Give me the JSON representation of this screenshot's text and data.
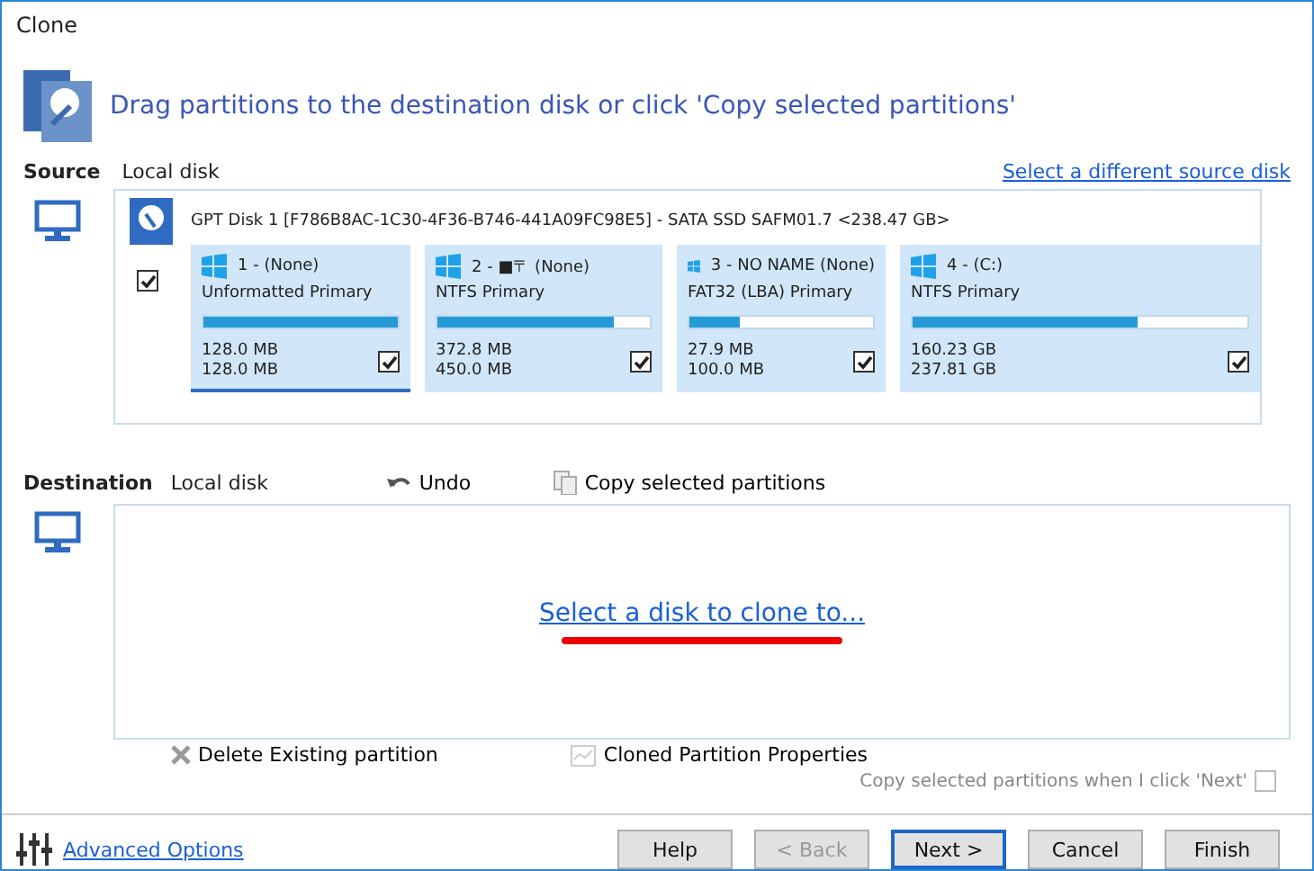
{
  "window": {
    "title": "Clone"
  },
  "header": {
    "text": "Drag partitions to the destination disk or click 'Copy selected partitions'"
  },
  "source": {
    "label": "Source",
    "disk_type": "Local disk",
    "change_link": "Select a different source disk",
    "disk": {
      "title": "GPT Disk 1 [F786B8AC-1C30-4F36-B746-441A09FC98E5] - SATA SSD SAFM01.7  <238.47 GB>",
      "checked": true,
      "partitions": [
        {
          "name": "1 -  (None)",
          "type": "Unformatted Primary",
          "level": 1.0,
          "used": "128.0 MB",
          "total": "128.0 MB",
          "checked": true,
          "selected": true
        },
        {
          "name": "2 - ■〒 (None)",
          "type": "NTFS Primary",
          "level": 0.83,
          "used": "372.8 MB",
          "total": "450.0 MB",
          "checked": true,
          "selected": false
        },
        {
          "name": "3 - NO NAME (None)",
          "type": "FAT32 (LBA) Primary",
          "level": 0.27,
          "used": "27.9 MB",
          "total": "100.0 MB",
          "checked": true,
          "selected": false
        },
        {
          "name": "4 -  (C:)",
          "type": "NTFS Primary",
          "level": 0.67,
          "used": "160.23 GB",
          "total": "237.81 GB",
          "checked": true,
          "selected": false
        }
      ]
    }
  },
  "destination": {
    "label": "Destination",
    "disk_type": "Local disk",
    "undo": "Undo",
    "copy": "Copy selected partitions",
    "select_link": "Select a disk to clone to..."
  },
  "actions": [
    {
      "label": "Delete Existing partition",
      "kind": "delete"
    },
    {
      "label": "Cloned Partition Properties",
      "kind": "properties"
    }
  ],
  "copy_on_next": {
    "label": "Copy selected partitions when I click 'Next'",
    "checked": false,
    "disabled": true
  },
  "advanced": "Advanced Options",
  "buttons": [
    {
      "label": "Help",
      "disabled": false,
      "default": false
    },
    {
      "label": "< Back",
      "disabled": true,
      "default": false
    },
    {
      "label": "Next >",
      "disabled": false,
      "default": true
    },
    {
      "label": "Cancel",
      "disabled": false,
      "default": false
    },
    {
      "label": "Finish",
      "disabled": false,
      "default": false
    }
  ]
}
